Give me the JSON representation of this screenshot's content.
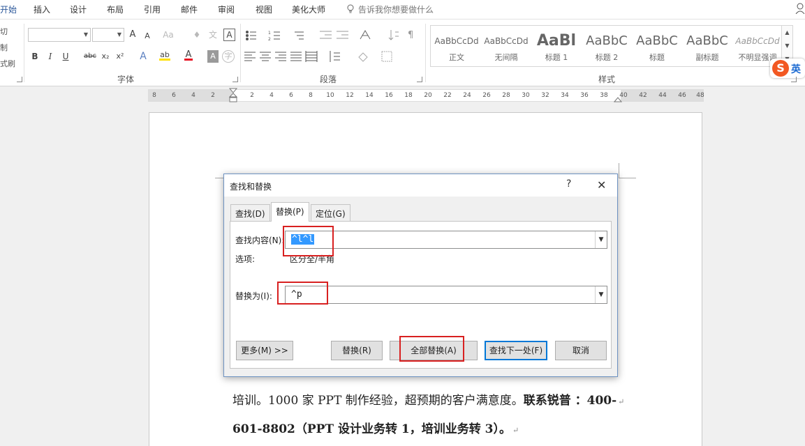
{
  "menu": {
    "tabs": [
      "开始",
      "插入",
      "设计",
      "布局",
      "引用",
      "邮件",
      "审阅",
      "视图",
      "美化大师"
    ],
    "tellme": "告诉我你想要做什么"
  },
  "ribbon": {
    "clipboard": {
      "cut": "切",
      "copy": "制",
      "painter": "式刷"
    },
    "font_group_label": "字体",
    "paragraph_group_label": "段落",
    "styles_group_label": "样式",
    "buttons": {
      "grow": "A",
      "shrink": "A",
      "case": "Aa",
      "clear": "♦",
      "phonetic": "文",
      "border_char": "A",
      "bold": "B",
      "italic": "I",
      "underline": "U",
      "strike": "abc",
      "sub": "x₂",
      "sup": "x²",
      "effects": "A",
      "highlight": "ab",
      "fontcolor": "A",
      "shade": "A",
      "encircle": "字"
    },
    "styles": [
      {
        "sample": "AaBbCcDd",
        "name": "正文"
      },
      {
        "sample": "AaBbCcDd",
        "name": "无间隔"
      },
      {
        "sample": "AaBl",
        "name": "标题 1"
      },
      {
        "sample": "AaBbC",
        "name": "标题 2"
      },
      {
        "sample": "AaBbC",
        "name": "标题"
      },
      {
        "sample": "AaBbC",
        "name": "副标题"
      },
      {
        "sample": "AaBbCcDd",
        "name": "不明显强调"
      }
    ],
    "ime": "英"
  },
  "ruler": {
    "labels": [
      "8",
      "6",
      "4",
      "2",
      "2",
      "4",
      "6",
      "8",
      "10",
      "12",
      "14",
      "16",
      "18",
      "20",
      "22",
      "24",
      "26",
      "28",
      "30",
      "32",
      "34",
      "36",
      "38",
      "40",
      "42",
      "44",
      "46",
      "48"
    ]
  },
  "document": {
    "line1": "培训。1000 家 PPT 制作经验，超预期的客户满意度。",
    "line1_bold": "联系锐普 ：400-",
    "line2_bold": "601-8802（PPT 设计业务转 1，培训业务转 3）。",
    "mark": "↵"
  },
  "dialog": {
    "title": "查找和替换",
    "help": "?",
    "close": "✕",
    "tabs": [
      "查找(D)",
      "替换(P)",
      "定位(G)"
    ],
    "find_label": "查找内容(N):",
    "find_value": "^l^l",
    "options_label": "选项:",
    "options_value": "区分全/半角",
    "replace_label": "替换为(I):",
    "replace_value": "^p",
    "buttons": {
      "more": "更多(M) >>",
      "replace": "替换(R)",
      "replace_all": "全部替换(A)",
      "find_next": "查找下一处(F)",
      "cancel": "取消"
    }
  },
  "colors": {
    "accent": "#2b579a",
    "highlight_red": "#d82020",
    "selection": "#3399ff",
    "highlight_yellow": "#ffe000",
    "font_red": "#e81123"
  }
}
